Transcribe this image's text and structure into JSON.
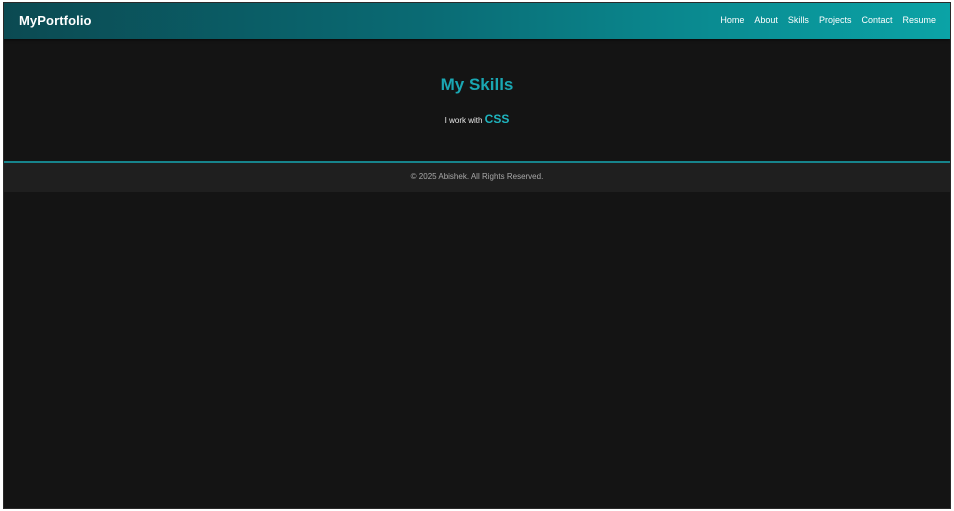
{
  "navbar": {
    "brand": "MyPortfolio",
    "links": [
      "Home",
      "About",
      "Skills",
      "Projects",
      "Contact",
      "Resume"
    ]
  },
  "skills": {
    "title": "My Skills",
    "prefix": "I work with",
    "current_skill": "CSS"
  },
  "footer": {
    "text": "© 2025 Abishek. All Rights Reserved."
  },
  "colors": {
    "accent": "#1aa7b3",
    "background": "#141414",
    "footer_bg": "#1f1f1f",
    "divider": "#17848c"
  }
}
